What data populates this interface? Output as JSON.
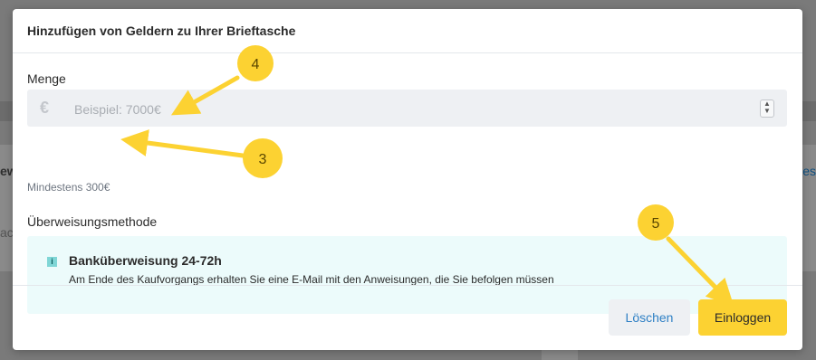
{
  "backdrop": {
    "left_fragment": "ew",
    "right_fragment": "les",
    "left_fragment2": "ac"
  },
  "modal": {
    "title": "Hinzufügen von Geldern zu Ihrer Brieftasche",
    "amount": {
      "label": "Menge",
      "currency_symbol": "€",
      "placeholder": "Beispiel: 7000€",
      "hint": "Mindestens 300€"
    },
    "method": {
      "label": "Überweisungsmethode",
      "option_title": "Banküberweisung 24-72h",
      "option_desc": "Am Ende des Kaufvorgangs erhalten Sie eine E-Mail mit den Anweisungen, die Sie befolgen müssen"
    },
    "footer": {
      "cancel_label": "Löschen",
      "submit_label": "Einloggen"
    }
  },
  "annotations": {
    "badges": [
      "4",
      "3",
      "5"
    ],
    "color": "#fcd232"
  },
  "colors": {
    "primary_button": "#fcd232",
    "cancel_text": "#2f80c5",
    "info_bg": "#ecfbfb"
  }
}
